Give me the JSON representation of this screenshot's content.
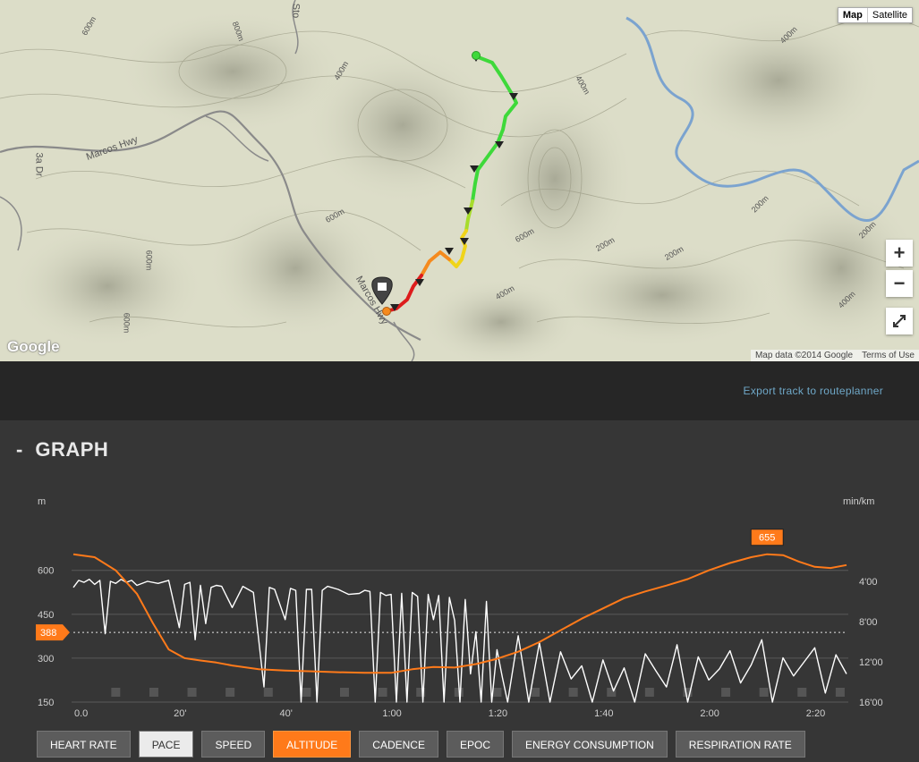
{
  "map": {
    "type_buttons": [
      {
        "label": "Map",
        "active": true
      },
      {
        "label": "Satellite",
        "active": false
      }
    ],
    "zoom_in": "+",
    "zoom_out": "−",
    "logo": "Google",
    "attribution": "Map data ©2014 Google",
    "terms": "Terms of Use",
    "road_labels": [
      "Marcos Hwy",
      "Marcos Hwy",
      "3a Dr",
      "Sto"
    ],
    "contour_labels": [
      "600m",
      "800m",
      "400m",
      "600m",
      "400m",
      "200m",
      "400m",
      "600m",
      "200m",
      "600m",
      "400m",
      "200m",
      "200m",
      "400m",
      "600m"
    ],
    "colors": {
      "background": "#dcddc8",
      "river": "#7ba3cf",
      "road": "#8a8a8a"
    }
  },
  "export_link": "Export track to routeplanner",
  "graph": {
    "collapse_icon": "-",
    "title": "GRAPH"
  },
  "chart_data": {
    "type": "line",
    "left_axis": {
      "unit": "m",
      "ticks": [
        600,
        450,
        300,
        150
      ],
      "range": [
        150,
        700
      ]
    },
    "right_axis": {
      "unit": "min/km",
      "ticks": [
        "4'00",
        "8'00",
        "12'00",
        "16'00"
      ],
      "range_minutes": [
        0,
        16
      ]
    },
    "x_ticks": [
      "0.0",
      "20'",
      "40'",
      "1:00",
      "1:20",
      "1:40",
      "2:00",
      "2:20"
    ],
    "x_range_minutes": [
      0,
      146
    ],
    "reference_line": {
      "label": "388",
      "value": 388
    },
    "max_marker": {
      "label": "655",
      "value": 655
    },
    "series": [
      {
        "name": "ALTITUDE",
        "color": "#ff7a1a",
        "x": [
          0,
          4,
          8,
          12,
          15,
          18,
          21,
          24,
          27,
          30,
          35,
          40,
          45,
          50,
          55,
          60,
          64,
          68,
          72,
          76,
          80,
          84,
          88,
          92,
          96,
          100,
          104,
          108,
          112,
          116,
          120,
          124,
          128,
          131,
          134,
          137,
          140,
          143,
          146
        ],
        "y": [
          655,
          645,
          600,
          520,
          420,
          330,
          300,
          292,
          285,
          275,
          262,
          258,
          255,
          252,
          250,
          250,
          262,
          270,
          268,
          280,
          298,
          322,
          355,
          395,
          435,
          470,
          505,
          528,
          548,
          570,
          600,
          625,
          645,
          655,
          652,
          630,
          612,
          608,
          618
        ]
      },
      {
        "name": "PACE",
        "color": "#ffffff",
        "x": [
          0,
          1,
          2,
          3,
          4,
          5,
          6,
          7,
          8,
          9,
          10,
          11,
          12,
          14,
          16,
          18,
          20,
          21,
          22,
          23,
          24,
          25,
          26,
          27,
          28,
          30,
          32,
          34,
          36,
          37,
          38,
          40,
          41,
          42,
          43,
          44,
          45,
          46,
          47,
          48,
          50,
          52,
          54,
          55,
          56,
          57,
          58,
          59,
          60,
          61,
          62,
          63,
          64,
          65,
          66,
          67,
          68,
          69,
          70,
          71,
          72,
          73,
          74,
          75,
          76,
          77,
          78,
          79,
          80,
          81,
          82,
          84,
          86,
          88,
          90,
          92,
          94,
          96,
          98,
          100,
          102,
          104,
          106,
          108,
          110,
          112,
          114,
          116,
          118,
          120,
          122,
          124,
          126,
          128,
          130,
          132,
          134,
          136,
          138,
          140,
          142,
          144,
          146
        ],
        "y": [
          4.6,
          3.9,
          4.1,
          3.8,
          4.3,
          3.9,
          9.2,
          4.0,
          4.2,
          3.8,
          4.1,
          3.9,
          4.4,
          4.0,
          4.2,
          3.9,
          8.6,
          4.3,
          4.1,
          9.8,
          4.4,
          8.2,
          4.6,
          4.4,
          4.5,
          6.6,
          4.5,
          5.1,
          14.5,
          4.6,
          4.8,
          7.8,
          4.7,
          4.9,
          16.0,
          4.8,
          4.8,
          16.0,
          4.9,
          4.5,
          4.8,
          5.3,
          5.2,
          4.9,
          5.0,
          16.0,
          5.1,
          5.4,
          5.3,
          16.0,
          5.2,
          16.0,
          5.1,
          5.5,
          16.0,
          5.3,
          7.8,
          5.4,
          16.0,
          5.6,
          7.9,
          16.0,
          5.8,
          13.2,
          9.0,
          16.0,
          6.0,
          16.0,
          10.8,
          13.5,
          16.0,
          9.4,
          16.0,
          10.1,
          16.0,
          11.0,
          13.7,
          12.4,
          16.0,
          11.8,
          14.9,
          12.6,
          16.0,
          11.2,
          12.9,
          14.5,
          10.3,
          16.0,
          11.5,
          13.8,
          12.7,
          10.9,
          14.1,
          12.3,
          9.8,
          16.0,
          11.6,
          13.4,
          12.0,
          10.6,
          15.1,
          11.3,
          13.2
        ]
      }
    ]
  },
  "tabs": [
    {
      "label": "HEART RATE",
      "state": "default"
    },
    {
      "label": "PACE",
      "state": "white"
    },
    {
      "label": "SPEED",
      "state": "default"
    },
    {
      "label": "ALTITUDE",
      "state": "orange"
    },
    {
      "label": "CADENCE",
      "state": "default"
    },
    {
      "label": "EPOC",
      "state": "default"
    },
    {
      "label": "ENERGY CONSUMPTION",
      "state": "default"
    },
    {
      "label": "RESPIRATION RATE",
      "state": "default"
    }
  ]
}
